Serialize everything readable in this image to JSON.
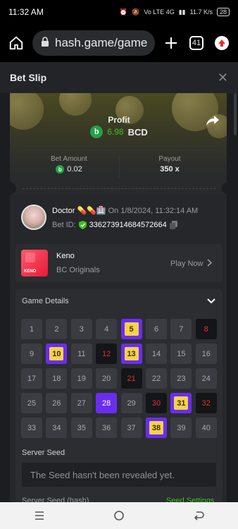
{
  "status": {
    "time": "11:32 AM",
    "network": "Vo LTE 4G",
    "speed": "11.7 K/s",
    "battery": "28"
  },
  "browser": {
    "url": "hash.game/game",
    "tab_count": "41"
  },
  "header": {
    "title": "Bet Slip",
    "close": "✕"
  },
  "profit": {
    "label": "Profit",
    "amount": "6.98",
    "currency": "BCD",
    "coin_glyph": "b"
  },
  "bet": {
    "amount_label": "Bet Amount",
    "amount": "0.02",
    "payout_label": "Payout",
    "payout": "350 x"
  },
  "player": {
    "name": "Doctor 💊💊🏥",
    "date": "On 1/8/2024, 11:32:14 AM",
    "bet_id_label": "Bet ID:",
    "bet_id": "336273914684572664"
  },
  "game": {
    "name": "Keno",
    "category": "BC Originals",
    "play_label": "Play Now",
    "thumb_text": "KENO"
  },
  "details": {
    "title": "Game Details"
  },
  "keno": {
    "cells": [
      {
        "n": "1",
        "state": "normal"
      },
      {
        "n": "2",
        "state": "normal"
      },
      {
        "n": "3",
        "state": "normal"
      },
      {
        "n": "4",
        "state": "normal"
      },
      {
        "n": "5",
        "state": "hit"
      },
      {
        "n": "6",
        "state": "normal"
      },
      {
        "n": "7",
        "state": "normal"
      },
      {
        "n": "8",
        "state": "miss"
      },
      {
        "n": "9",
        "state": "normal"
      },
      {
        "n": "10",
        "state": "hit"
      },
      {
        "n": "11",
        "state": "normal"
      },
      {
        "n": "12",
        "state": "miss"
      },
      {
        "n": "13",
        "state": "hit"
      },
      {
        "n": "14",
        "state": "normal"
      },
      {
        "n": "15",
        "state": "normal"
      },
      {
        "n": "16",
        "state": "normal"
      },
      {
        "n": "17",
        "state": "normal"
      },
      {
        "n": "18",
        "state": "normal"
      },
      {
        "n": "19",
        "state": "normal"
      },
      {
        "n": "20",
        "state": "normal"
      },
      {
        "n": "21",
        "state": "miss"
      },
      {
        "n": "22",
        "state": "normal"
      },
      {
        "n": "23",
        "state": "normal"
      },
      {
        "n": "24",
        "state": "normal"
      },
      {
        "n": "25",
        "state": "normal"
      },
      {
        "n": "26",
        "state": "normal"
      },
      {
        "n": "27",
        "state": "normal"
      },
      {
        "n": "28",
        "state": "pick"
      },
      {
        "n": "29",
        "state": "normal"
      },
      {
        "n": "30",
        "state": "miss"
      },
      {
        "n": "31",
        "state": "hit"
      },
      {
        "n": "32",
        "state": "miss"
      },
      {
        "n": "33",
        "state": "normal"
      },
      {
        "n": "34",
        "state": "normal"
      },
      {
        "n": "35",
        "state": "normal"
      },
      {
        "n": "36",
        "state": "normal"
      },
      {
        "n": "37",
        "state": "normal"
      },
      {
        "n": "38",
        "state": "hit"
      },
      {
        "n": "39",
        "state": "normal"
      },
      {
        "n": "40",
        "state": "normal"
      }
    ]
  },
  "seed": {
    "label": "Server Seed",
    "value": "The Seed hasn't been revealed yet.",
    "hash_label": "Server Seed (hash)",
    "settings_label": "Seed Settings"
  },
  "colors": {
    "accent_green": "#3bc117",
    "pick_purple": "#6a2df0",
    "hit_yellow": "#f3d24c",
    "miss_red": "#e0302e"
  }
}
